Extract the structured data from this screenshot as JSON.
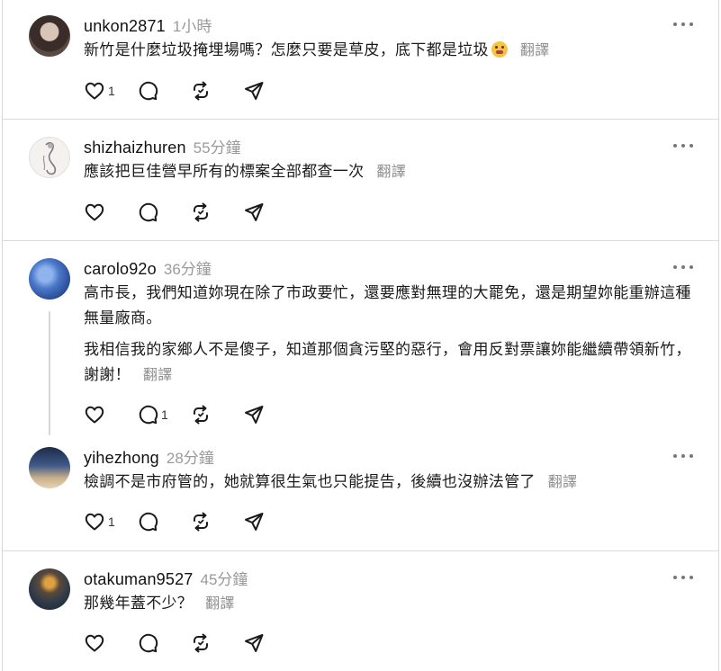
{
  "translate_label": "翻譯",
  "posts": [
    {
      "username": "unkon2871",
      "time": "1小時",
      "paragraphs": [
        "新竹是什麼垃圾掩埋場嗎？怎麼只要是草皮，底下都是垃圾"
      ],
      "emoji": "grimacing-face",
      "like_count": "1",
      "reply_count": ""
    },
    {
      "username": "shizhaizhuren",
      "time": "55分鐘",
      "paragraphs": [
        "應該把巨佳營早所有的標案全部都查一次"
      ],
      "like_count": "",
      "reply_count": ""
    },
    {
      "username": "carolo92o",
      "time": "36分鐘",
      "paragraphs": [
        "高市長，我們知道妳現在除了市政要忙，還要應對無理的大罷免，還是期望妳能重辦這種無量廠商。",
        "我相信我的家鄉人不是傻子，知道那個貪污堅的惡行，會用反對票讓妳能繼續帶領新竹，謝謝！"
      ],
      "like_count": "",
      "reply_count": "1"
    },
    {
      "username": "yihezhong",
      "time": "28分鐘",
      "paragraphs": [
        "檢調不是市府管的，她就算很生氣也只能提告，後續也沒辦法管了"
      ],
      "like_count": "1",
      "reply_count": ""
    },
    {
      "username": "otakuman9527",
      "time": "45分鐘",
      "paragraphs": [
        "那幾年蓋不少？"
      ],
      "like_count": "",
      "reply_count": ""
    }
  ],
  "icons": {
    "like": "heart-icon",
    "reply": "comment-icon",
    "repost": "repost-icon",
    "share": "send-icon",
    "more": "more-icon"
  },
  "colors": {
    "text": "#1a1a1a",
    "muted": "#9a9a9a",
    "divider": "#dcdcdc"
  }
}
